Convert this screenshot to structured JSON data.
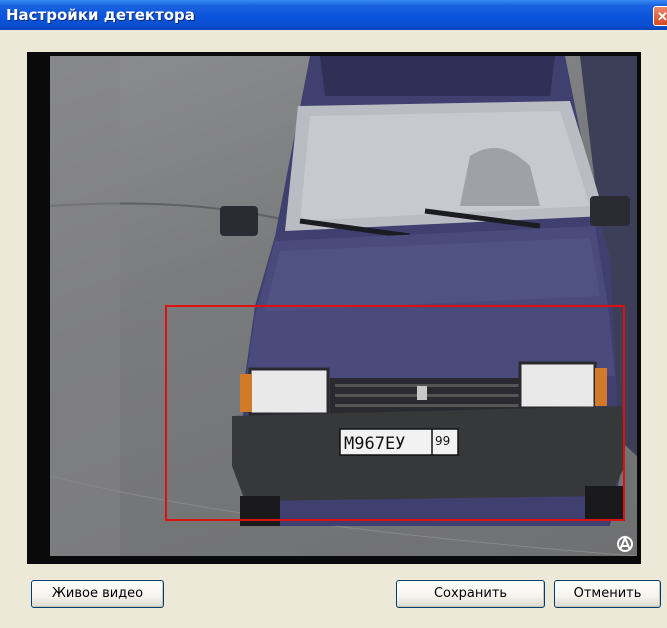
{
  "window": {
    "title": "Настройки детектора",
    "close_glyph": "✕"
  },
  "video": {
    "plate_text": "М967ЕУ",
    "plate_region": "99"
  },
  "buttons": {
    "live_video": "Живое видео",
    "save": "Сохранить",
    "cancel": "Отменить"
  },
  "colors": {
    "detection_zone": "#e01010",
    "titlebar": "#0a54dc"
  }
}
